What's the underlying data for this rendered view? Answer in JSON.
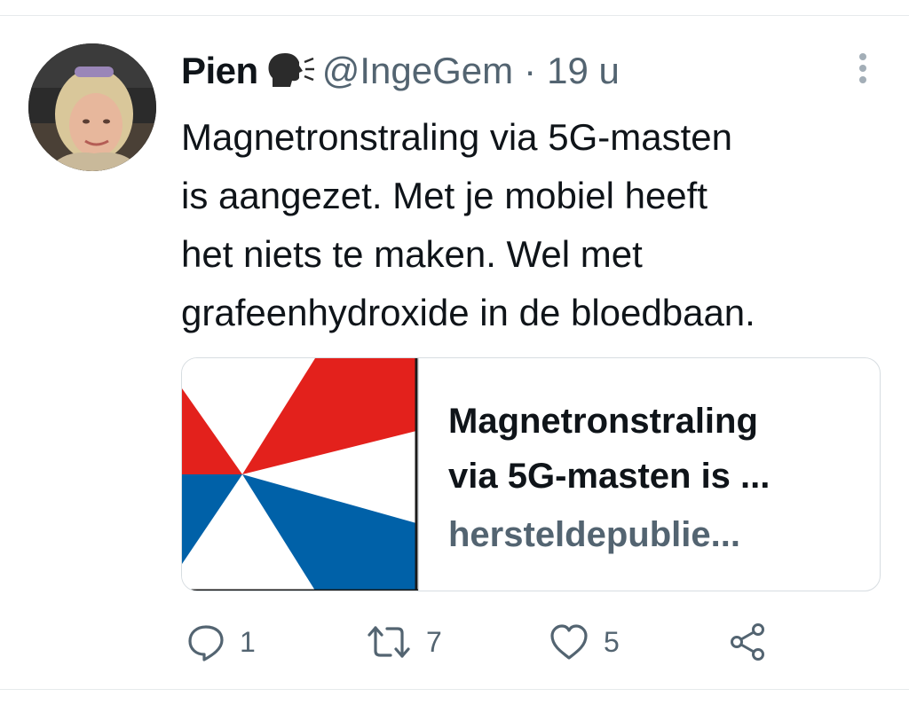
{
  "tweet": {
    "display_name": "Pien",
    "name_emoji": "speaking-head-icon",
    "handle": "@IngeGem",
    "separator": "·",
    "time": "19 u",
    "text_lines": [
      "Magnetronstraling via 5G-masten",
      "is aangezet. Met je mobiel heeft",
      "het niets te maken. Wel met",
      "grafeenhydroxide in de bloedbaan."
    ]
  },
  "card": {
    "title_lines": [
      "Magnetronstraling",
      "via 5G-masten is ..."
    ],
    "domain": "hersteldepublie..."
  },
  "actions": {
    "reply_count": "1",
    "retweet_count": "7",
    "like_count": "5"
  },
  "colors": {
    "text_primary": "#0f1419",
    "text_secondary": "#536471",
    "flag_red": "#e3211c",
    "flag_blue": "#0061a8",
    "border": "#d7dde1"
  }
}
